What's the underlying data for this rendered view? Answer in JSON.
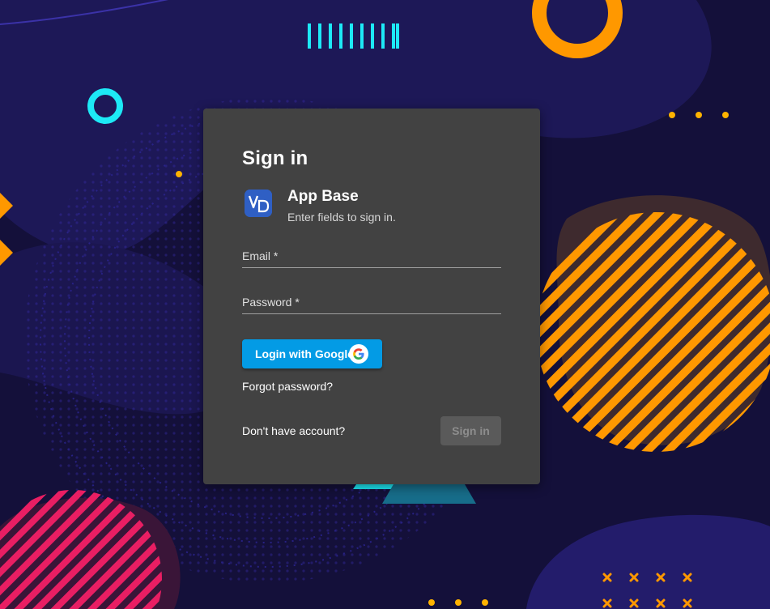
{
  "theme": {
    "background": "#14103a",
    "card_background": "#424242",
    "primary_button": "#039be5",
    "accent_orange": "#ff9800",
    "accent_cyan": "#1de9f6",
    "accent_pink": "#e91e63"
  },
  "signin": {
    "title": "Sign in",
    "app_logo_icon": "vd-logo-icon",
    "app_name": "App Base",
    "app_subtitle": "Enter fields to sign in.",
    "email_label": "Email *",
    "email_value": "",
    "password_label": "Password *",
    "password_value": "",
    "google_button_label": "Login with Google",
    "google_icon": "google-g-icon",
    "forgot_password": "Forgot password?",
    "no_account": "Don't have account?",
    "signin_button_label": "Sign in",
    "signin_button_state": "disabled"
  }
}
